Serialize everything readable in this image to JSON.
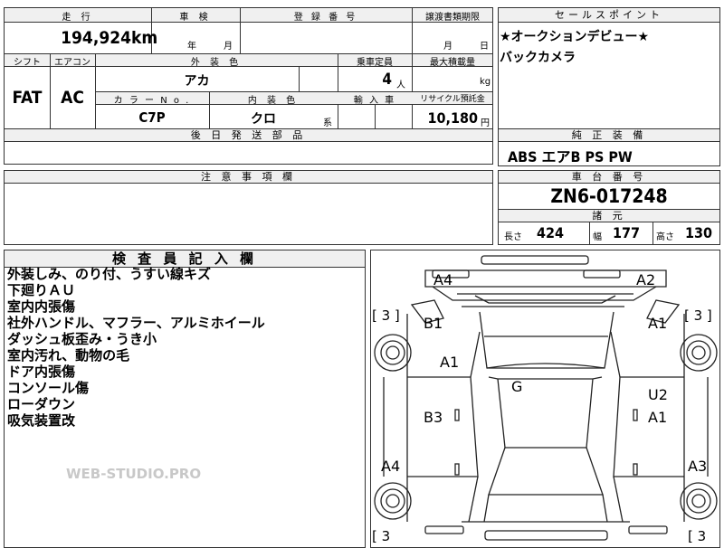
{
  "top": {
    "mileage_label": "走 行",
    "mileage_value": "194,924",
    "mileage_unit": "km",
    "inspection_label": "車 検",
    "inspection_year": "年",
    "inspection_month": "月",
    "registration_label": "登 録 番 号",
    "transfer_label": "譲渡書類期限",
    "transfer_month": "月",
    "transfer_day": "日",
    "shift_label": "シフト",
    "shift_value": "FAT",
    "ac_label": "エアコン",
    "ac_value": "AC",
    "exterior_color_label": "外 装 色",
    "exterior_color_value": "アカ",
    "capacity_label": "乗車定員",
    "capacity_value": "4",
    "capacity_unit": "人",
    "max_load_label": "最大積載量",
    "max_load_unit": "kg",
    "color_no_label": "カ ラ ー N o .",
    "color_no_value": "C7P",
    "interior_color_label": "内 装 色",
    "interior_color_value": "クロ",
    "interior_color_suffix": "系",
    "import_label": "輸 入 車",
    "recycle_label": "リサイクル預託金",
    "recycle_value": "10,180",
    "recycle_unit": "円",
    "later_parts_label": "後 日 発 送 部 品"
  },
  "sales_points": {
    "label": "セールスポイント",
    "lines": [
      "★オークションデビュー★",
      "バックカメラ"
    ]
  },
  "equipment": {
    "label": "純 正 装 備",
    "value": "ABS エアB PS PW"
  },
  "notes": {
    "label": "注 意 事 項 欄"
  },
  "chassis": {
    "label": "車 台 番 号",
    "value": "ZN6-017248",
    "specs_label": "諸 元",
    "length_label": "長さ",
    "length_value": "424",
    "width_label": "幅",
    "width_value": "177",
    "height_label": "高さ",
    "height_value": "130"
  },
  "inspector": {
    "label": "検 査 員 記 入 欄",
    "lines": [
      "外装しみ、のり付、うすい線キズ",
      "下廻りＡＵ",
      "室内内張傷",
      "社外ハンドル、マフラー、アルミホイール",
      "ダッシュ板歪み・うき小",
      "室内汚れ、動物の毛",
      "ドア内張傷",
      "コンソール傷",
      "ローダウン",
      "吸気装置改"
    ]
  },
  "watermark": "WEB-STUDIO.PRO",
  "diagram": {
    "marks": {
      "a4_top": "A4",
      "a2_top": "A2",
      "b1": "B1",
      "a1_left": "A1",
      "a1_right_top": "A1",
      "g": "G",
      "u2": "U2",
      "a1_right_mid": "A1",
      "b3": "B3",
      "a4_bottom": "A4",
      "a3": "A3"
    },
    "brackets": {
      "tl": "[ 3 ]",
      "tr": "[ 3 ]",
      "bl": "[ 3",
      "br": "[ 3"
    }
  }
}
